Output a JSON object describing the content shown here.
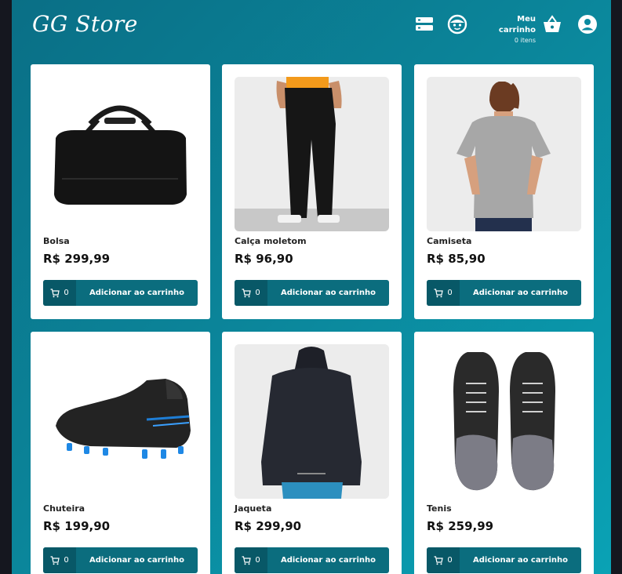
{
  "header": {
    "logo": "GG Store",
    "cart_title": "Meu carrinho",
    "cart_count": "0 itens",
    "icons": [
      "list-icon",
      "face-icon",
      "basket-icon",
      "account-icon"
    ]
  },
  "colors": {
    "primary": "#0b6d7e",
    "primary_dark": "#085867",
    "background_start": "#0a6f86",
    "background_end": "#0aa2b5"
  },
  "products": [
    {
      "name": "Bolsa",
      "price": "R$ 299,99",
      "qty": "0",
      "button": "Adicionar ao carrinho",
      "image": "duffel-bag"
    },
    {
      "name": "Calça moletom",
      "price": "R$ 96,90",
      "qty": "0",
      "button": "Adicionar ao carrinho",
      "image": "sweatpants"
    },
    {
      "name": "Camiseta",
      "price": "R$ 85,90",
      "qty": "0",
      "button": "Adicionar ao carrinho",
      "image": "t-shirt"
    },
    {
      "name": "Chuteira",
      "price": "R$ 199,90",
      "qty": "0",
      "button": "Adicionar ao carrinho",
      "image": "football-boot"
    },
    {
      "name": "Jaqueta",
      "price": "R$ 299,90",
      "qty": "0",
      "button": "Adicionar ao carrinho",
      "image": "jacket"
    },
    {
      "name": "Tenis",
      "price": "R$ 259,99",
      "qty": "0",
      "button": "Adicionar ao carrinho",
      "image": "sneakers"
    }
  ]
}
